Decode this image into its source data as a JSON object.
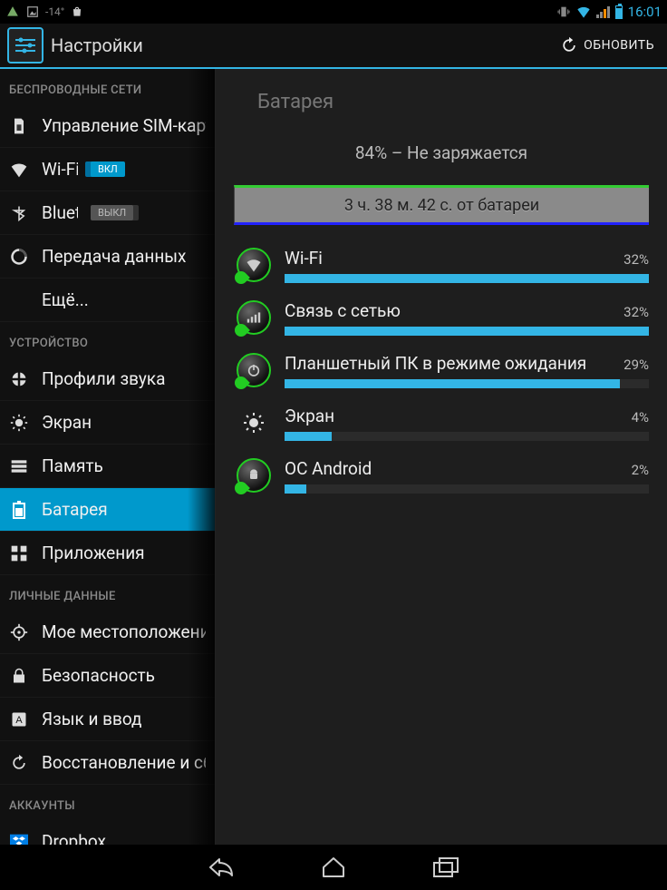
{
  "status": {
    "temp": "-14°",
    "time": "16:01"
  },
  "actionbar": {
    "title": "Настройки",
    "refresh": "ОБНОВИТЬ"
  },
  "sidebar": {
    "section_wireless": "БЕСПРОВОДНЫЕ СЕТИ",
    "section_device": "УСТРОЙСТВО",
    "section_personal": "ЛИЧНЫЕ ДАННЫЕ",
    "section_accounts": "АККАУНТЫ",
    "items": {
      "sim": {
        "label": "Управление SIM-картами"
      },
      "wifi": {
        "label": "Wi-Fi",
        "toggle": "ВКЛ"
      },
      "bt": {
        "label": "Bluetooth",
        "toggle": "ВЫКЛ"
      },
      "data": {
        "label": "Передача данных"
      },
      "more": {
        "label": "Ещё..."
      },
      "sound": {
        "label": "Профили звука"
      },
      "display": {
        "label": "Экран"
      },
      "storage": {
        "label": "Память"
      },
      "battery": {
        "label": "Батарея"
      },
      "apps": {
        "label": "Приложения"
      },
      "location": {
        "label": "Мое местоположение"
      },
      "security": {
        "label": "Безопасность"
      },
      "language": {
        "label": "Язык и ввод"
      },
      "backup": {
        "label": "Восстановление и сброс"
      },
      "dropbox": {
        "label": "Dropbox"
      }
    }
  },
  "battery": {
    "title": "Батарея",
    "summary": "84% – Не заряжается",
    "chart_caption": "3 ч. 38 м. 42 с. от батареи",
    "usage": [
      {
        "label": "Wi-Fi",
        "pct_text": "32%",
        "fill": 100,
        "icon": "wifi-ring"
      },
      {
        "label": "Связь с сетью",
        "pct_text": "32%",
        "fill": 100,
        "icon": "signal-ring"
      },
      {
        "label": "Планшетный ПК в режиме ожидания",
        "pct_text": "29%",
        "fill": 92,
        "icon": "power-ring"
      },
      {
        "label": "Экран",
        "pct_text": "4%",
        "fill": 13,
        "icon": "brightness"
      },
      {
        "label": "ОС Android",
        "pct_text": "2%",
        "fill": 6,
        "icon": "android-ring"
      }
    ]
  }
}
